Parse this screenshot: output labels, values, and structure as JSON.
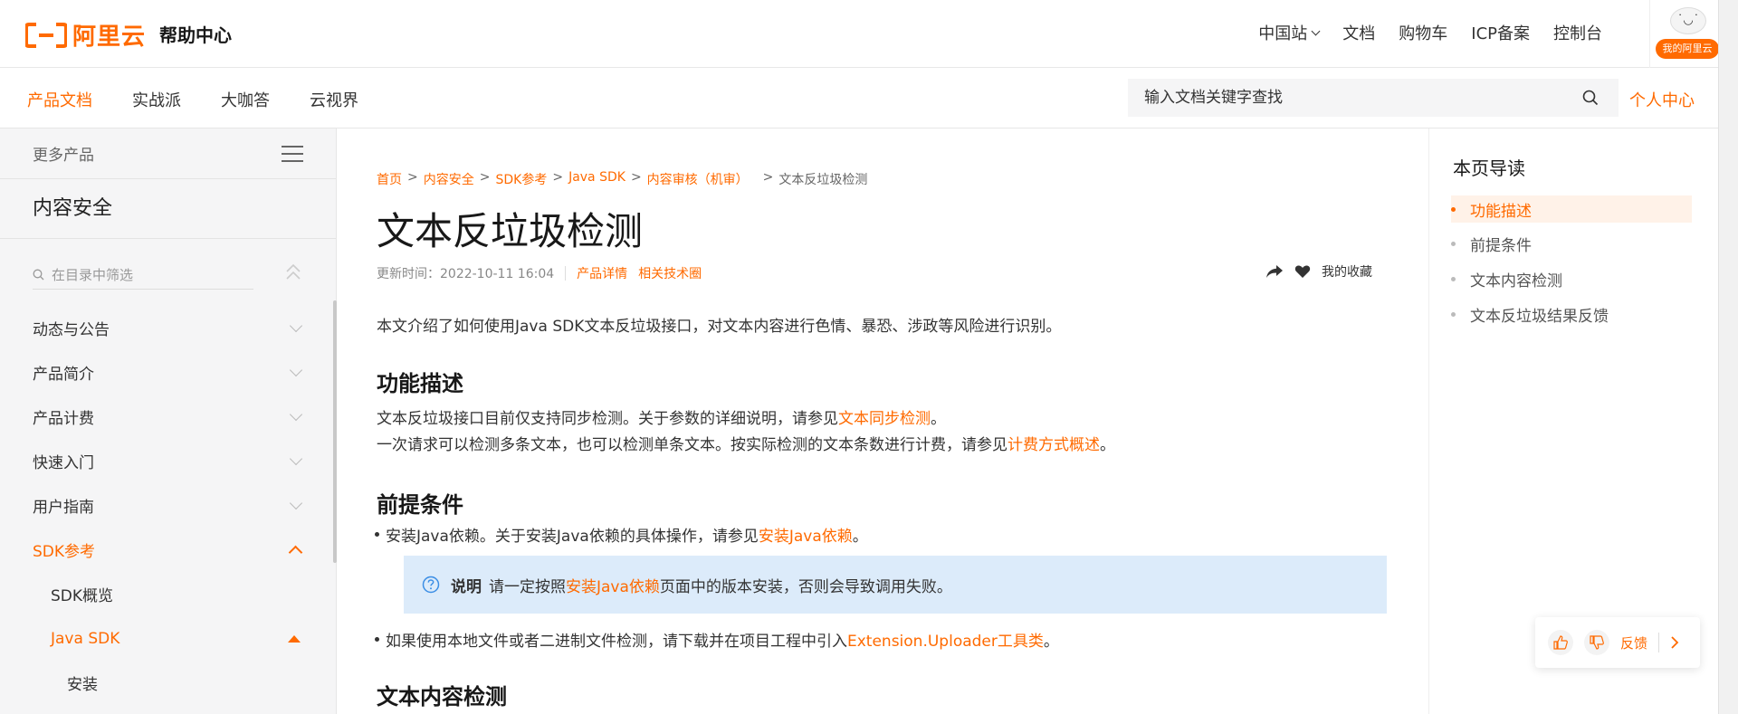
{
  "header": {
    "logo_text": "阿里云",
    "help_title": "帮助中心",
    "nav": [
      {
        "label": "中国站"
      },
      {
        "label": "文档"
      },
      {
        "label": "购物车"
      },
      {
        "label": "ICP备案"
      },
      {
        "label": "控制台"
      }
    ],
    "avatar_face": "˙◡˙",
    "my_aliyun": "我的阿里云"
  },
  "subnav": {
    "tabs": [
      "产品文档",
      "实战派",
      "大咖答",
      "云视界"
    ],
    "active_tab": "产品文档",
    "search_placeholder": "输入文档关键字查找",
    "personal_center": "个人中心"
  },
  "sidebar": {
    "more_products": "更多产品",
    "product_name": "内容安全",
    "filter_placeholder": "在目录中筛选",
    "items": [
      {
        "label": "动态与公告"
      },
      {
        "label": "产品简介"
      },
      {
        "label": "产品计费"
      },
      {
        "label": "快速入门"
      },
      {
        "label": "用户指南"
      },
      {
        "label": "SDK参考"
      },
      {
        "label": "SDK概览"
      },
      {
        "label": "Java SDK"
      },
      {
        "label": "安装"
      }
    ]
  },
  "content": {
    "breadcrumb": [
      "首页",
      "内容安全",
      "SDK参考",
      "Java SDK",
      "内容审核（机审）",
      "文本反垃圾检测"
    ],
    "breadcrumb_sep": ">",
    "title": "文本反垃圾检测",
    "updated": "更新时间：2022-10-11 16:04",
    "product_details": "产品详情",
    "related_circle": "相关技术圈",
    "favorite": "我的收藏",
    "intro": "本文介绍了如何使用Java SDK文本反垃圾接口，对文本内容进行色情、暴恐、涉政等风险进行识别。",
    "sections": {
      "func_title": "功能描述",
      "func_p1_before": "文本反垃圾接口目前仅支持同步检测。关于参数的详细说明，请参见",
      "func_p1_link": "文本同步检测",
      "func_p1_after": "。",
      "func_p2_before": "一次请求可以检测多条文本，也可以检测单条文本。按实际检测的文本条数进行计费，请参见",
      "func_p2_link": "计费方式概述",
      "func_p2_after": "。",
      "pre_title": "前提条件",
      "pre_b1_before": "安装Java依赖。关于安装Java依赖的具体操作，请参见",
      "pre_b1_link": "安装Java依赖",
      "pre_b1_after": "。",
      "note_label": "说明",
      "note_before": "请一定按照",
      "note_link": "安装Java依赖",
      "note_after": "页面中的版本安装，否则会导致调用失败。",
      "pre_b2_before": "如果使用本地文件或者二进制文件检测，请下载并在项目工程中引入",
      "pre_b2_link": "Extension.Uploader工具类",
      "pre_b2_after": "。",
      "text_title": "文本内容检测"
    }
  },
  "toc": {
    "title": "本页导读",
    "items": [
      "功能描述",
      "前提条件",
      "文本内容检测",
      "文本反垃圾结果反馈"
    ],
    "active": "功能描述"
  },
  "feedback": {
    "label": "反馈"
  },
  "colors": {
    "brand": "#ff6a00",
    "note_bg": "#dcebfa",
    "sidebar_bg": "#f5f5f6"
  }
}
